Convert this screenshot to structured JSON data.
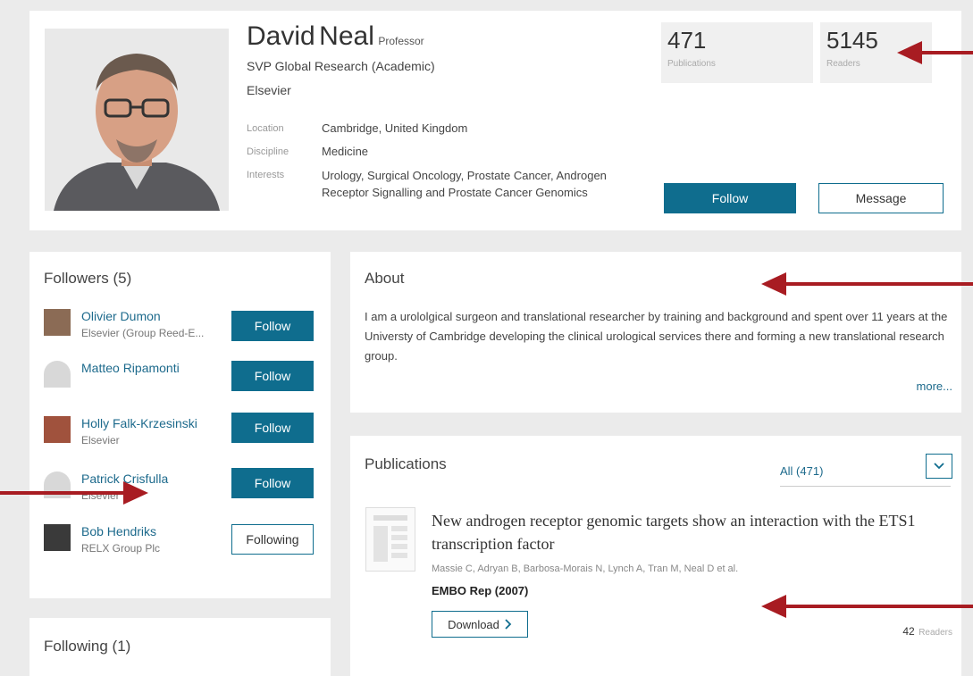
{
  "profile": {
    "first_name": "David",
    "last_name": "Neal",
    "rank": "Professor",
    "title": "SVP Global Research (Academic)",
    "org": "Elsevier",
    "details": [
      {
        "label": "Location",
        "value": "Cambridge, United Kingdom"
      },
      {
        "label": "Discipline",
        "value": "Medicine"
      },
      {
        "label": "Interests",
        "value": "Urology, Surgical Oncology, Prostate Cancer, Androgen Receptor Signalling and Prostate Cancer Genomics"
      }
    ],
    "stats": [
      {
        "value": "471",
        "label": "Publications"
      },
      {
        "value": "5145",
        "label": "Readers"
      }
    ],
    "follow_label": "Follow",
    "message_label": "Message"
  },
  "followers": {
    "title": "Followers (5)",
    "items": [
      {
        "name": "Olivier Dumon",
        "org": "Elsevier (Group Reed-E...",
        "button": "Follow",
        "state": "follow"
      },
      {
        "name": "Matteo Ripamonti",
        "org": "",
        "button": "Follow",
        "state": "follow"
      },
      {
        "name": "Holly Falk-Krzesinski",
        "org": "Elsevier",
        "button": "Follow",
        "state": "follow"
      },
      {
        "name": "Patrick Crisfulla",
        "org": "Elsevier",
        "button": "Follow",
        "state": "follow"
      },
      {
        "name": "Bob Hendriks",
        "org": "RELX Group Plc",
        "button": "Following",
        "state": "following"
      }
    ]
  },
  "following": {
    "title": "Following (1)"
  },
  "about": {
    "title": "About",
    "text": "I am a urololgical surgeon and translational researcher by training and background and spent over 11 years at the Universty of Cambridge developing the clinical urological services there and forming a new translational research group.",
    "more": "more..."
  },
  "publications": {
    "title": "Publications",
    "filter": "All (471)",
    "items": [
      {
        "title": "New androgen receptor genomic targets show an interaction with the ETS1 transcription factor",
        "authors": "Massie C, Adryan B, Barbosa-Morais N, Lynch A, Tran M, Neal D et al.",
        "journal": "EMBO Rep (2007)",
        "download": "Download",
        "readers_count": "42",
        "readers_label": "Readers"
      }
    ]
  },
  "colors": {
    "accent": "#0f6d8e",
    "link": "#1d6a8c",
    "arrow": "#a81c22",
    "background": "#ebebeb"
  }
}
